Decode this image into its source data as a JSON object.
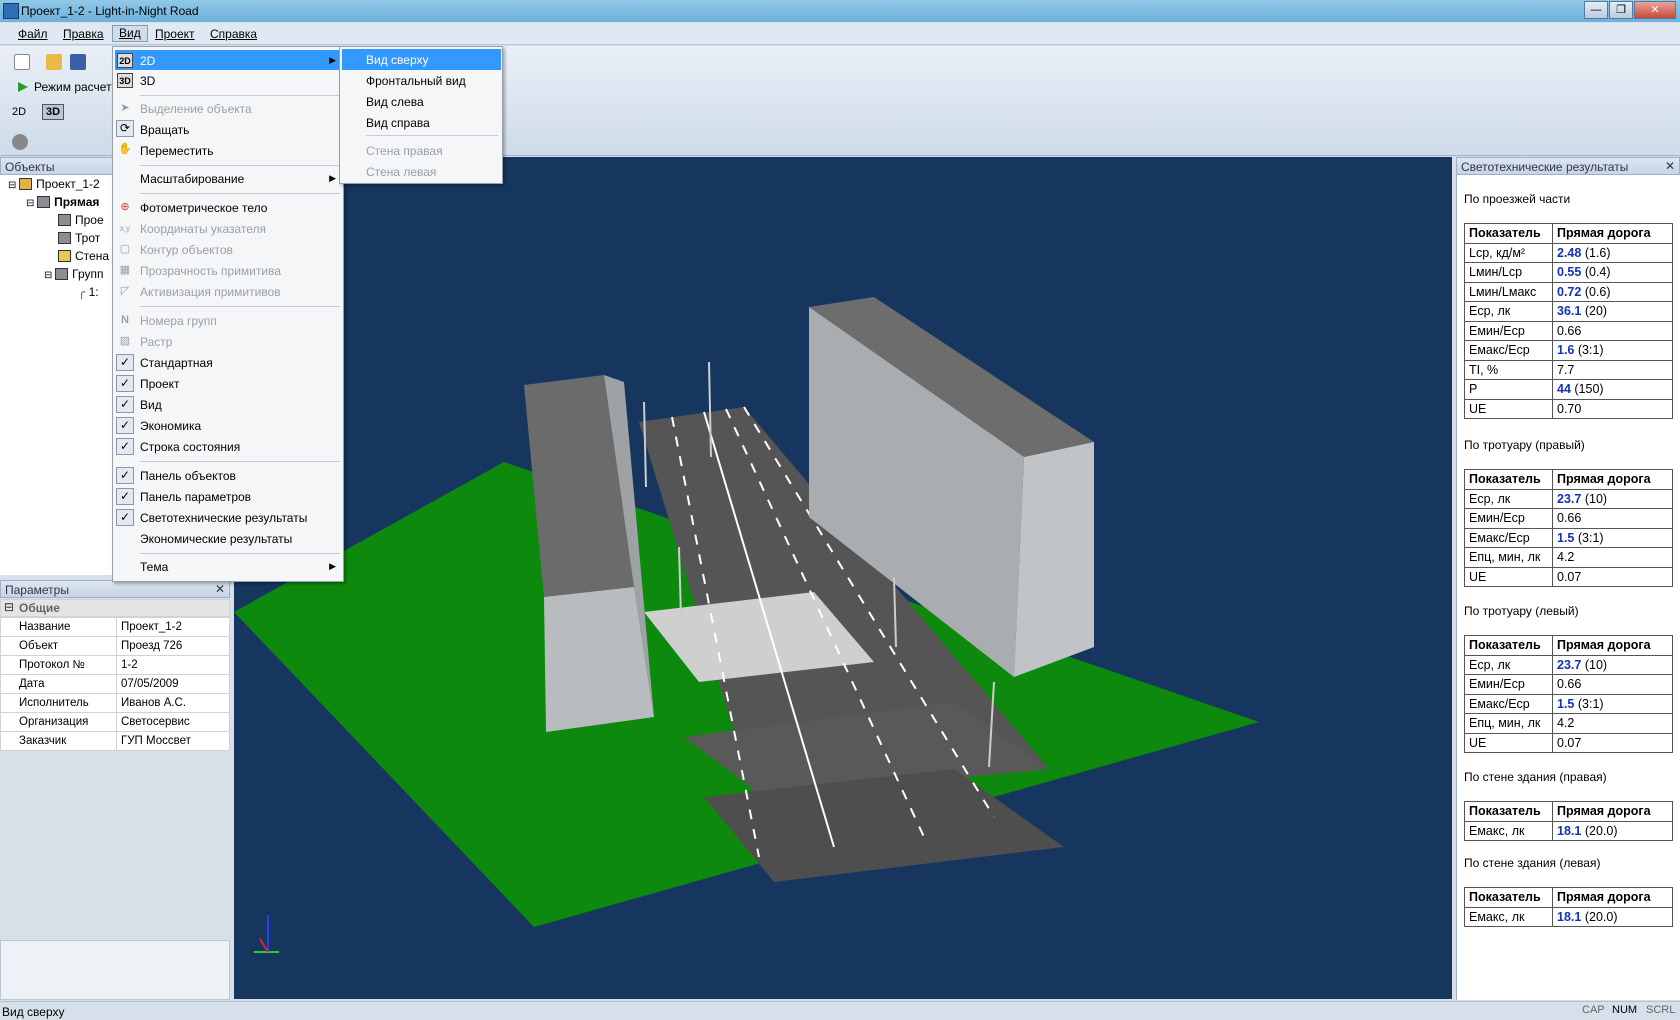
{
  "window": {
    "title": "Проект_1-2 - Light-in-Night Road"
  },
  "menubar": [
    "Файл",
    "Правка",
    "Вид",
    "Проект",
    "Справка"
  ],
  "toolbar": {
    "mode_label": "Режим расчет",
    "view2d": "2D",
    "view3d": "3D"
  },
  "objects_panel": {
    "title": "Объекты",
    "tree": [
      {
        "label": "Проект_1-2"
      },
      {
        "label": "Прямая"
      },
      {
        "label": "Прое"
      },
      {
        "label": "Трот"
      },
      {
        "label": "Стена"
      },
      {
        "label": "Групп"
      },
      {
        "label": "1:"
      }
    ]
  },
  "params_panel": {
    "title": "Параметры",
    "group": "Общие",
    "rows": [
      {
        "key": "Название",
        "value": "Проект_1-2"
      },
      {
        "key": "Объект",
        "value": "Проезд 726"
      },
      {
        "key": "Протокол №",
        "value": "1-2"
      },
      {
        "key": "Дата",
        "value": "07/05/2009"
      },
      {
        "key": "Исполнитель",
        "value": "Иванов А.С."
      },
      {
        "key": "Организация",
        "value": "Светосервис"
      },
      {
        "key": "Заказчик",
        "value": "ГУП Моссвет"
      }
    ]
  },
  "view_menu": {
    "items": [
      {
        "label": "2D",
        "icon": "2d-icon",
        "submenu": true,
        "highlighted": true
      },
      {
        "label": "3D",
        "icon": "3d-icon"
      },
      {
        "label": "Выделение объекта",
        "disabled": true,
        "icon": "cursor-icon"
      },
      {
        "label": "Вращать",
        "icon": "rotate-icon"
      },
      {
        "label": "Переместить",
        "icon": "hand-icon"
      },
      {
        "label": "Масштабирование",
        "submenu": true
      },
      {
        "label": "Фотометрическое тело",
        "icon": "photometric-icon"
      },
      {
        "label": "Координаты указателя",
        "disabled": true,
        "icon": "coords-icon"
      },
      {
        "label": "Контур объектов",
        "disabled": true,
        "icon": "contour-icon"
      },
      {
        "label": "Прозрачность примитива",
        "disabled": true,
        "icon": "transparency-icon"
      },
      {
        "label": "Активизация примитивов",
        "disabled": true,
        "icon": "activate-icon"
      },
      {
        "label": "Номера групп",
        "disabled": true,
        "icon": "group-numbers-icon"
      },
      {
        "label": "Растр",
        "disabled": true,
        "icon": "raster-icon"
      },
      {
        "label": "Стандартная",
        "checked": true
      },
      {
        "label": "Проект",
        "checked": true
      },
      {
        "label": "Вид",
        "checked": true
      },
      {
        "label": "Экономика",
        "checked": true
      },
      {
        "label": "Строка состояния",
        "checked": true
      },
      {
        "label": "Панель объектов",
        "checked": true
      },
      {
        "label": "Панель параметров",
        "checked": true
      },
      {
        "label": "Светотехнические результаты",
        "checked": true
      },
      {
        "label": "Экономические результаты"
      },
      {
        "label": "Тема",
        "submenu": true
      }
    ],
    "submenu_2d": [
      {
        "label": "Вид сверху",
        "highlighted": true
      },
      {
        "label": "Фронтальный вид"
      },
      {
        "label": "Вид слева"
      },
      {
        "label": "Вид справа"
      },
      {
        "label": "Стена правая",
        "disabled": true
      },
      {
        "label": "Стена левая",
        "disabled": true
      }
    ]
  },
  "results_panel": {
    "title": "Светотехнические результаты",
    "col_header": [
      "Показатель",
      "Прямая дорога"
    ],
    "sections": [
      {
        "title": "По проезжей части",
        "rows": [
          {
            "name": "Lср, кд/м²",
            "value": "2.48",
            "norm": "(1.6)"
          },
          {
            "name": "Lмин/Lср",
            "value": "0.55",
            "norm": "(0.4)"
          },
          {
            "name": "Lмин/Lмакс",
            "value": "0.72",
            "norm": "(0.6)"
          },
          {
            "name": "Eср, лк",
            "value": "36.1",
            "norm": "(20)"
          },
          {
            "name": "Eмин/Eср",
            "value": "0.66",
            "norm": ""
          },
          {
            "name": "Eмакс/Eср",
            "value": "1.6",
            "norm": "(3:1)"
          },
          {
            "name": "TI, %",
            "value": "7.7",
            "norm": ""
          },
          {
            "name": "P",
            "value": "44",
            "norm": "(150)"
          },
          {
            "name": "UE",
            "value": "0.70",
            "norm": ""
          }
        ]
      },
      {
        "title": "По тротуару (правый)",
        "rows": [
          {
            "name": "Eср, лк",
            "value": "23.7",
            "norm": "(10)"
          },
          {
            "name": "Eмин/Eср",
            "value": "0.66",
            "norm": ""
          },
          {
            "name": "Eмакс/Eср",
            "value": "1.5",
            "norm": "(3:1)"
          },
          {
            "name": "Eпц, мин, лк",
            "value": "4.2",
            "norm": ""
          },
          {
            "name": "UE",
            "value": "0.07",
            "norm": ""
          }
        ]
      },
      {
        "title": "По тротуару (левый)",
        "rows": [
          {
            "name": "Eср, лк",
            "value": "23.7",
            "norm": "(10)"
          },
          {
            "name": "Eмин/Eср",
            "value": "0.66",
            "norm": ""
          },
          {
            "name": "Eмакс/Eср",
            "value": "1.5",
            "norm": "(3:1)"
          },
          {
            "name": "Eпц, мин, лк",
            "value": "4.2",
            "norm": ""
          },
          {
            "name": "UE",
            "value": "0.07",
            "norm": ""
          }
        ]
      },
      {
        "title": "По стене здания (правая)",
        "rows": [
          {
            "name": "Eмакс, лк",
            "value": "18.1",
            "norm": "(20.0)"
          }
        ]
      },
      {
        "title": "По стене здания (левая)",
        "rows": [
          {
            "name": "Eмакс, лк",
            "value": "18.1",
            "norm": "(20.0)"
          }
        ]
      }
    ]
  },
  "statusbar": {
    "text": "Вид сверху",
    "indicators": [
      "CAP",
      "NUM",
      "SCRL"
    ]
  },
  "colors": {
    "viewport_bg": "#16365f",
    "ground": "#0d8a0d",
    "menu_highlight": "#3399ff",
    "value_blue": "#1432b4"
  }
}
